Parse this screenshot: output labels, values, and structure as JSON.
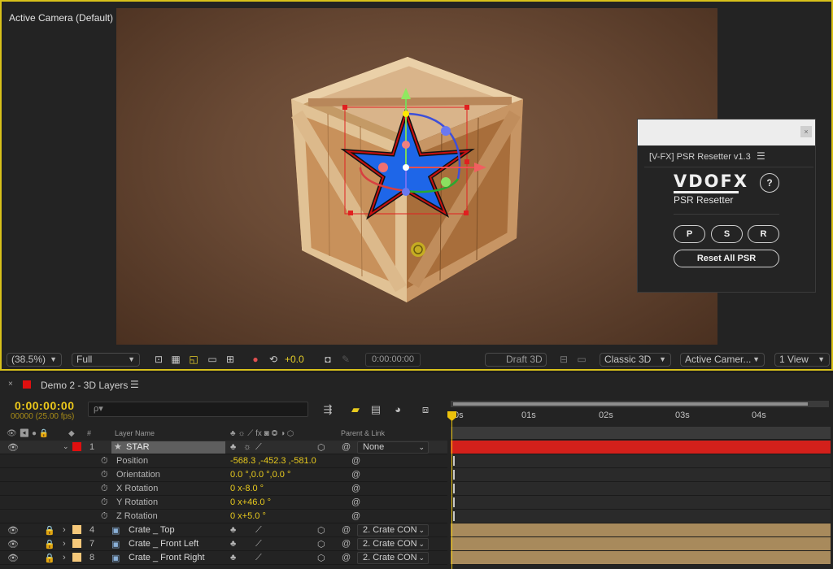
{
  "viewer": {
    "camera_label": "Active Camera (Default)",
    "zoom": "(38.5%)",
    "resolution": "Full",
    "exposure": "+0.0",
    "timecode": "0:00:00:00",
    "renderer_mode": "Draft 3D",
    "renderer": "Classic 3D",
    "active_camera": "Active Camer...",
    "view_layout": "1 View"
  },
  "psr_panel": {
    "tab_title": "[V-FX] PSR Resetter v1.3",
    "menu_icon": "hamburger-icon",
    "logo_text": "VDOFX",
    "subtitle": "PSR Resetter",
    "help": "?",
    "buttons": [
      "P",
      "S",
      "R"
    ],
    "reset_all": "Reset All PSR",
    "close": "×"
  },
  "timeline": {
    "tab_close": "×",
    "comp_name": "Demo 2 - 3D Layers",
    "comp_color": "#e00f0f",
    "timecode": "0:00:00:00",
    "frames": "00000 (25.00 fps)",
    "search_placeholder": "ρ▾",
    "columns": {
      "number": "#",
      "layer_name": "Layer Name",
      "parent": "Parent & Link"
    },
    "ruler": [
      "0s",
      "01s",
      "02s",
      "03s",
      "04s"
    ],
    "layers": [
      {
        "num": "1",
        "name": "STAR",
        "color": "#e00f0f",
        "parent": "None",
        "expanded": true
      },
      {
        "num": "4",
        "name": "Crate _ Top",
        "color": "#f5c87a",
        "parent": "2. Crate CON",
        "expanded": false
      },
      {
        "num": "7",
        "name": "Crate _ Front Left",
        "color": "#f5c87a",
        "parent": "2. Crate CON",
        "expanded": false
      },
      {
        "num": "8",
        "name": "Crate _ Front Right",
        "color": "#f5c87a",
        "parent": "2. Crate CON",
        "expanded": false
      }
    ],
    "properties": [
      {
        "name": "Position",
        "value": "-568.3 ,-452.3 ,-581.0"
      },
      {
        "name": "Orientation",
        "value": "0.0 °,0.0 °,0.0 °"
      },
      {
        "name": "X Rotation",
        "value": "0 x-8.0 °"
      },
      {
        "name": "Y Rotation",
        "value": "0 x+46.0 °"
      },
      {
        "name": "Z Rotation",
        "value": "0 x+5.0 °"
      }
    ]
  },
  "colors": {
    "accent_yellow": "#e8ca1e",
    "star_blue": "#1e66e8",
    "track_red": "#d3201b",
    "track_tan": "#a88a5c"
  }
}
